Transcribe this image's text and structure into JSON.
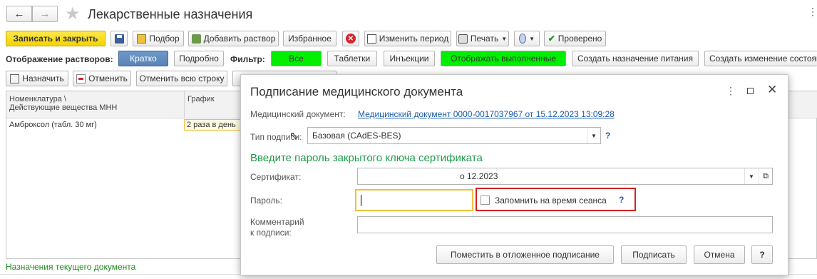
{
  "window": {
    "title": "Лекарственные назначения",
    "nav_back": "←",
    "nav_forward": "→",
    "star": "★"
  },
  "toolbar1": {
    "save_close": "Записать и закрыть",
    "podbor": "Подбор",
    "add_solution": "Добавить раствор",
    "favorites": "Избранное",
    "change_period": "Изменить период",
    "print": "Печать",
    "checked": "Проверено"
  },
  "toolbar2": {
    "display_label": "Отображение растворов:",
    "brief": "Кратко",
    "detailed": "Подробно",
    "filter_label": "Фильтр:",
    "all": "Все",
    "tablets": "Таблетки",
    "injections": "Инъекции",
    "show_done": "Отображать выполненные",
    "create_nutrition": "Создать назначение питания",
    "create_change": "Создать изменение состояния"
  },
  "toolbar3": {
    "assign": "Назначить",
    "cancel": "Отменить",
    "cancel_row": "Отменить всю строку"
  },
  "grid": {
    "col1_line1": "Номенклатура \\",
    "col1_line2": "Действующие вещества МНН",
    "col2": "График",
    "row1_name": "Амброксол (табл. 30 мг)",
    "row1_schedule": "2 раза в день"
  },
  "footer": {
    "status": "Назначения текущего документа"
  },
  "dialog": {
    "title": "Подписание медицинского документа",
    "doc_label": "Медицинский документ:",
    "doc_link": "Медицинский документ 0000-0017037967 от 15.12.2023 13:09:28",
    "sig_type_label": "Тип подписи:",
    "sig_type_value": "Базовая (CAdES-BES)",
    "help": "?",
    "prompt": "Введите пароль закрытого ключа сертификата",
    "cert_label": "Сертификат:",
    "cert_value": "о 12.2023",
    "password_label": "Пароль:",
    "remember": "Запомнить на время сеанса",
    "comment_label_1": "Комментарий",
    "comment_label_2": "к подписи:",
    "btn_defer": "Поместить в отложенное подписание",
    "btn_sign": "Подписать",
    "btn_cancel": "Отмена",
    "btn_help": "?"
  }
}
